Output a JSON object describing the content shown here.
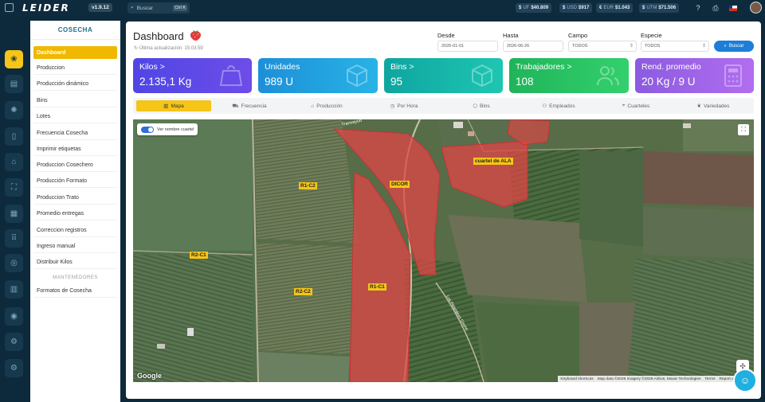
{
  "topbar": {
    "logo": "LEIDER",
    "version": "v1.9.12",
    "search_placeholder": "Buscar",
    "search_shortcut": "Ctrl K",
    "indicators": [
      {
        "label": "UF",
        "value": "$40.809"
      },
      {
        "label": "USD",
        "value": "$917"
      },
      {
        "label": "EUR",
        "value": "$1.043"
      },
      {
        "label": "UTM",
        "value": "$71.506"
      }
    ]
  },
  "sidenav": {
    "title": "COSECHA",
    "items": [
      "Dashboard",
      "Produccion",
      "Producción dinámico",
      "Bins",
      "Lotes",
      "Frecuencia Cosecha",
      "Imprimir etiquetas",
      "Produccion Cosechero",
      "Producción Formato",
      "Produccion Trato",
      "Promedio entregas",
      "Correccion registros",
      "Ingreso manual",
      "Distribuir Kilos"
    ],
    "section_label": "MANTENEDORES",
    "section_items": [
      "Formatos de Cosecha"
    ]
  },
  "header": {
    "title": "Dashboard",
    "last_update": "Última actualización: 15:03:59",
    "filters": {
      "desde_label": "Desde",
      "desde_value": "2026-01-01",
      "hasta_label": "Hasta",
      "hasta_value": "2026-06-26",
      "campo_label": "Campo",
      "campo_value": "TODOS",
      "especie_label": "Especie",
      "especie_value": "TODOS"
    },
    "search_button": "Buscar"
  },
  "cards": [
    {
      "label": "Kilos >",
      "value": "2.135,1 Kg",
      "color": "#5b4be0"
    },
    {
      "label": "Unidades",
      "value": "989 U",
      "color": "#1fa3dd"
    },
    {
      "label": "Bins >",
      "value": "95",
      "color": "#14b8a6"
    },
    {
      "label": "Trabajadores >",
      "value": "108",
      "color": "#22c55e"
    },
    {
      "label": "Rend. promedio",
      "value": "20 Kg / 9 U",
      "color": "#a36be6"
    }
  ],
  "tabs": [
    "Mapa",
    "Frecuencia",
    "Producción",
    "Por Hora",
    "Bins",
    "Empleados",
    "Cuarteles",
    "Variedades"
  ],
  "map": {
    "toggle_label": "Ver nombre cuartel",
    "labels": [
      "R1-C2",
      "DICOR",
      "cuartel de ALA",
      "R2-C1",
      "R2-C2",
      "R1-C1"
    ],
    "google": "Google",
    "attribution": [
      "Keyboard shortcuts",
      "Map data ©2026 Imagery ©2026 Airbus, Maxar Technologies",
      "Terms",
      "Report a map error"
    ]
  }
}
